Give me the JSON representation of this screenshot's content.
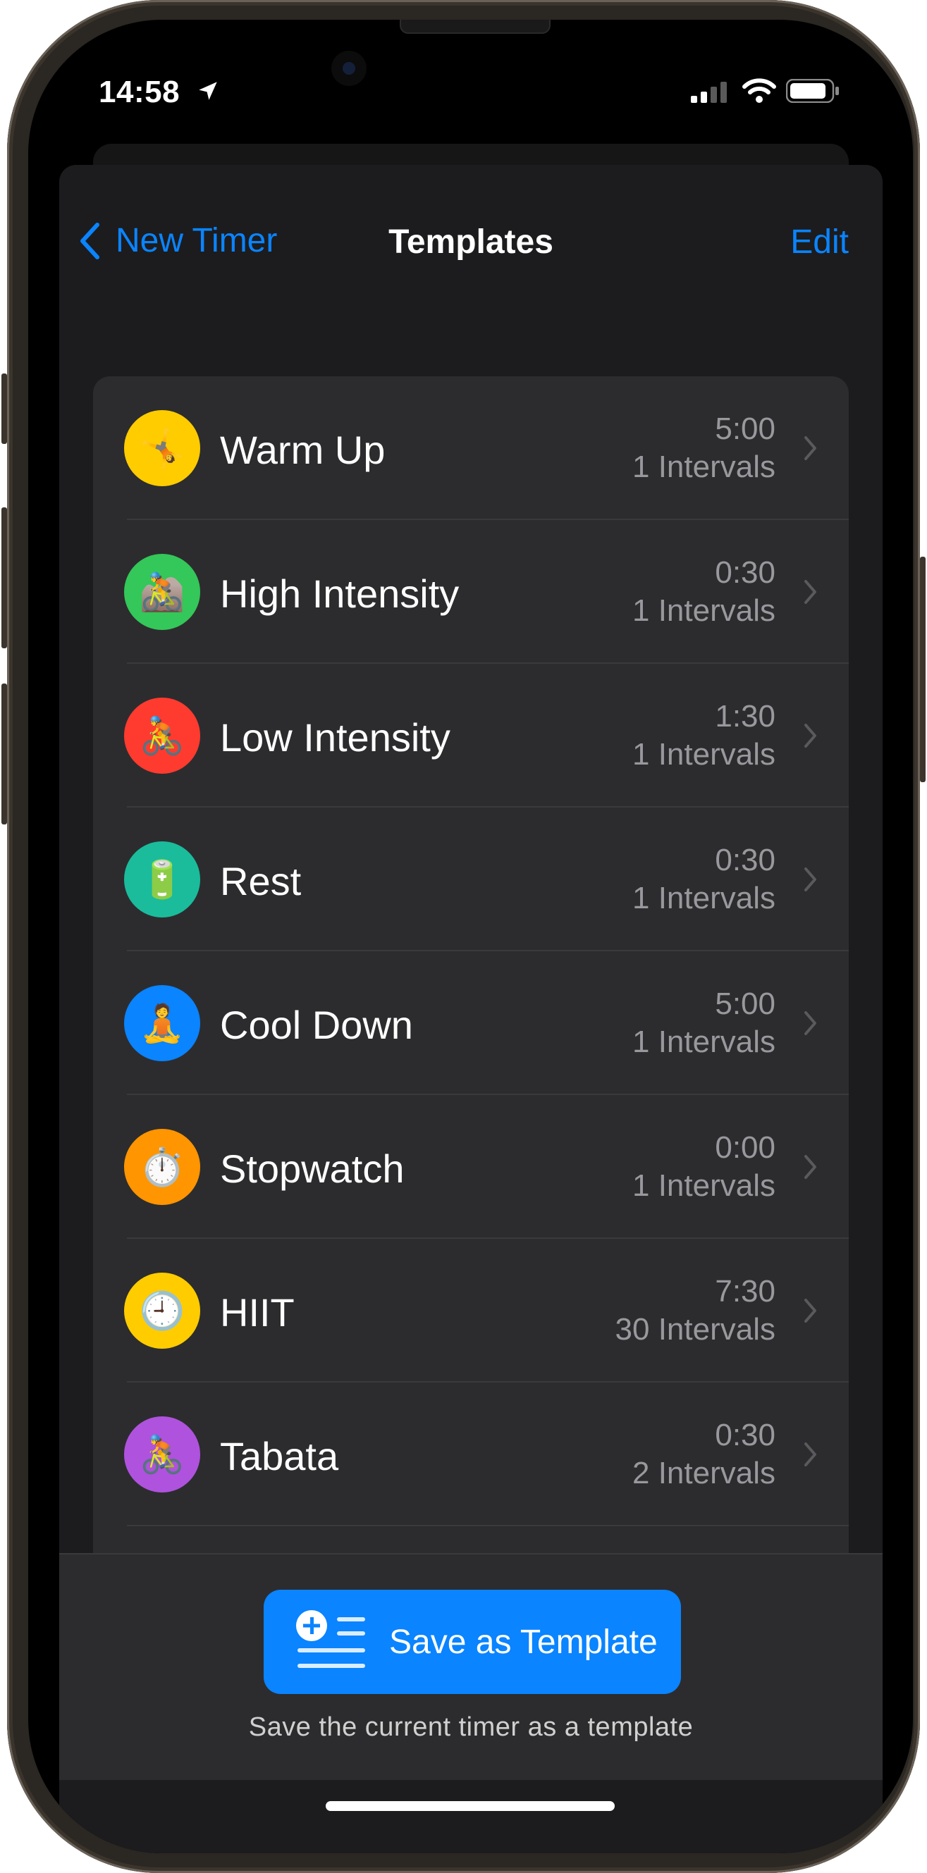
{
  "status_bar": {
    "time": "14:58",
    "icons": [
      "location-arrow-icon",
      "cellular-signal-icon",
      "wifi-icon",
      "battery-icon"
    ]
  },
  "nav": {
    "back_label": "New Timer",
    "title": "Templates",
    "edit_label": "Edit"
  },
  "templates": [
    {
      "name": "Warm Up",
      "duration": "5:00",
      "intervals": "1 Intervals",
      "color": "#ffcc00",
      "emoji": "🤸"
    },
    {
      "name": "High Intensity",
      "duration": "0:30",
      "intervals": "1 Intervals",
      "color": "#34c759",
      "emoji": "🚵"
    },
    {
      "name": "Low Intensity",
      "duration": "1:30",
      "intervals": "1 Intervals",
      "color": "#ff3b30",
      "emoji": "🚴"
    },
    {
      "name": "Rest",
      "duration": "0:30",
      "intervals": "1 Intervals",
      "color": "#1abc9c",
      "emoji": "🔋"
    },
    {
      "name": "Cool Down",
      "duration": "5:00",
      "intervals": "1 Intervals",
      "color": "#0a84ff",
      "emoji": "🧘"
    },
    {
      "name": "Stopwatch",
      "duration": "0:00",
      "intervals": "1 Intervals",
      "color": "#ff9500",
      "emoji": "⏱️"
    },
    {
      "name": "HIIT",
      "duration": "7:30",
      "intervals": "30 Intervals",
      "color": "#ffcc00",
      "emoji": "🕘"
    },
    {
      "name": "Tabata",
      "duration": "0:30",
      "intervals": "2 Intervals",
      "color": "#af52de",
      "emoji": "🚴"
    }
  ],
  "footer": {
    "save_button_label": "Save as Template",
    "caption": "Save the current timer as a template"
  },
  "colors": {
    "accent": "#0a84ff",
    "background": "#1c1c1e",
    "cell": "#2c2c2e"
  }
}
